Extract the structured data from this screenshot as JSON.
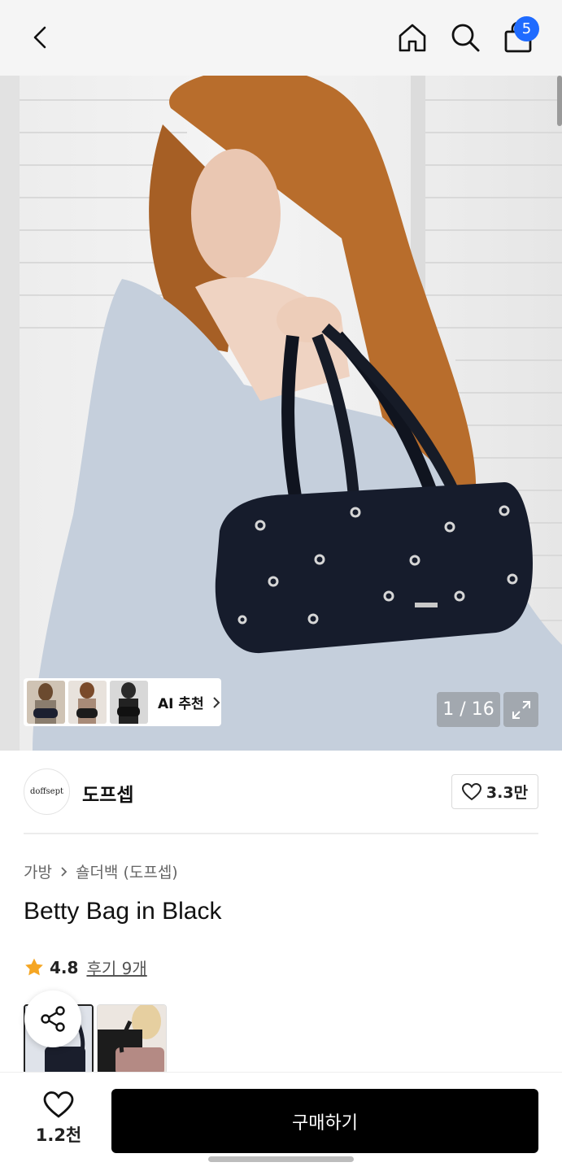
{
  "header": {
    "cart_count": "5",
    "icons": [
      "back-icon",
      "home-icon",
      "search-icon",
      "shopping-bag-icon"
    ]
  },
  "gallery": {
    "ai_label": "AI 추천",
    "counter": "1 / 16"
  },
  "shop": {
    "logo_text": "doffsept",
    "name": "도프셉",
    "likes": "3.3만"
  },
  "breadcrumb": {
    "category": "가방",
    "subcategory": "숄더백 (도프셉)"
  },
  "product": {
    "title": "Betty Bag in Black",
    "rating": "4.8",
    "reviews": "후기 9개"
  },
  "bottom": {
    "wish_count": "1.2천",
    "buy_label": "구매하기"
  },
  "colors": {
    "accent": "#1f6bff",
    "star": "#f5a623",
    "buy_button": "#000000"
  }
}
